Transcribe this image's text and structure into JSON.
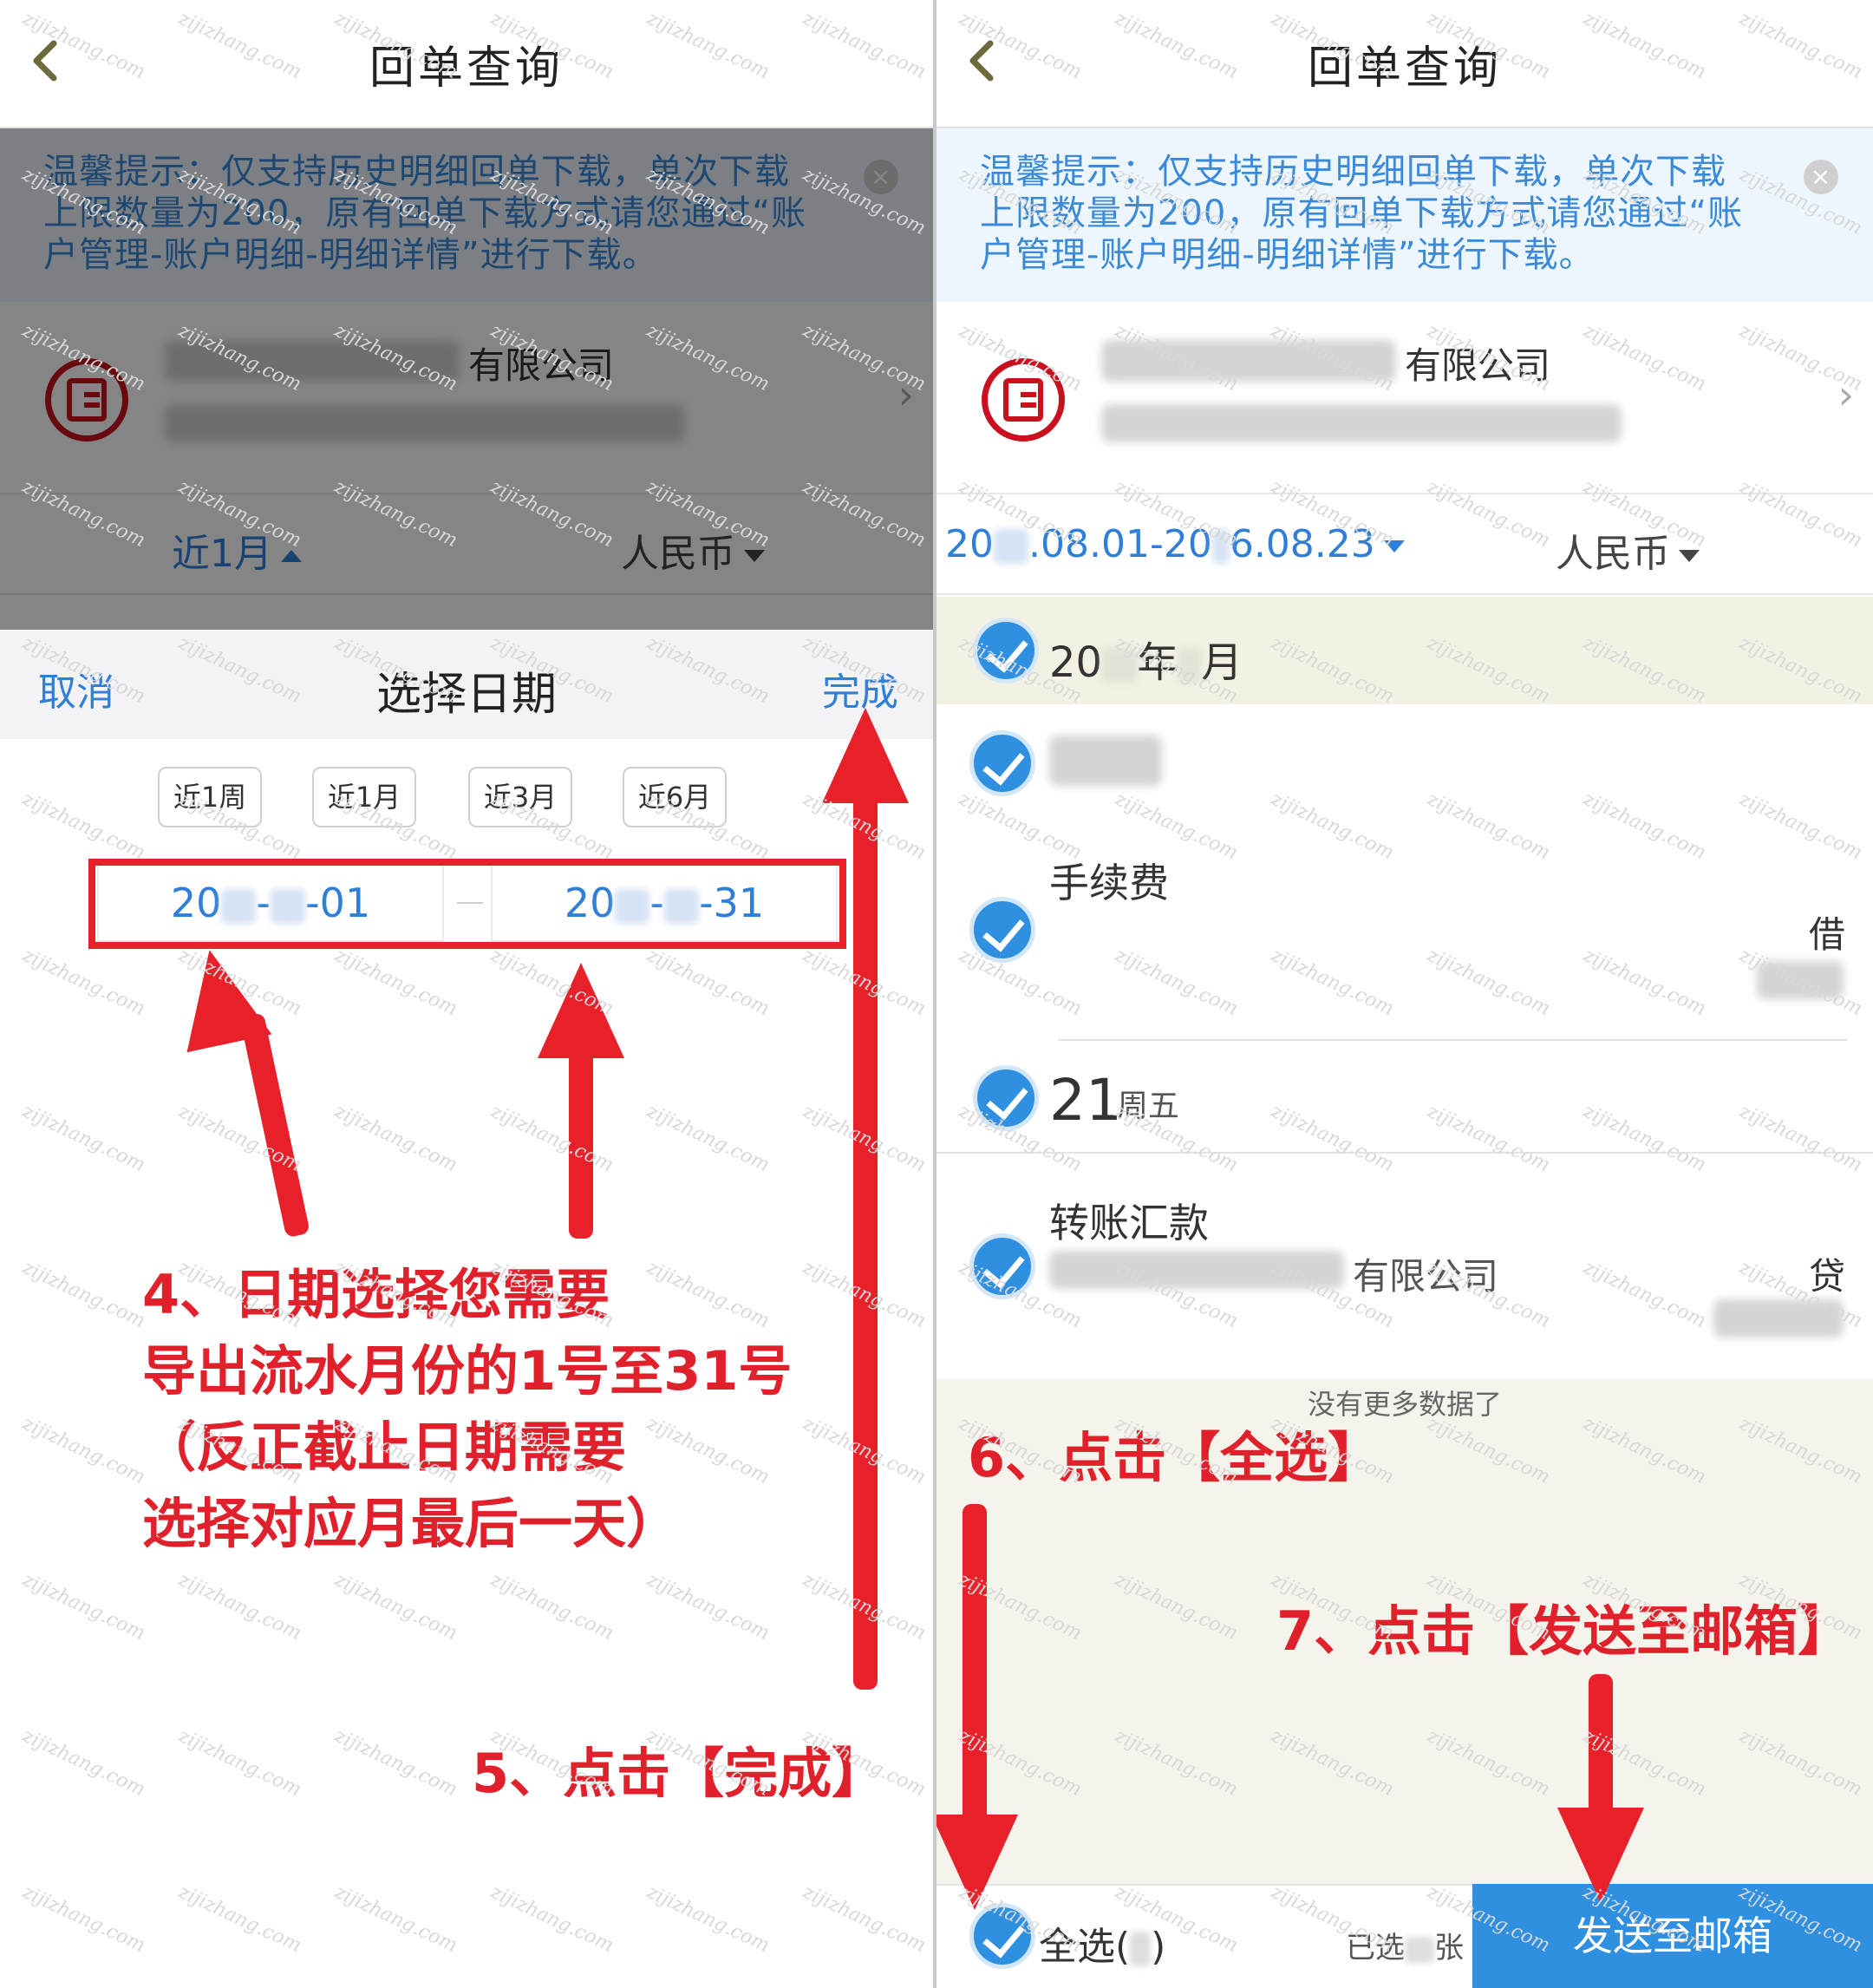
{
  "left": {
    "nav": {
      "title": "回单查询"
    },
    "tip": {
      "text": "温馨提示：仅支持历史明细回单下载，单次下载上限数量为200，原有回单下载方式请您通过“账户管理-账户明细-明细详情”进行下载。",
      "close": "×"
    },
    "account": {
      "name_suffix": "有限公司",
      "chevron": "›"
    },
    "filter": {
      "period": "近1月",
      "currency": "人民币"
    },
    "sheet": {
      "cancel": "取消",
      "title": "选择日期",
      "done": "完成"
    },
    "chips": [
      "近1周",
      "近1月",
      "近3月",
      "近6月"
    ],
    "date_start": {
      "prefix": "20",
      "mid": "-",
      "suffix": "-01"
    },
    "date_end": {
      "prefix": "20",
      "mid": "-",
      "suffix": "-31"
    },
    "annotations": {
      "step4_line1": "4、日期选择您需要",
      "step4_line2": "导出流水月份的1号至31号",
      "step4_line3": "（反正截止日期需要",
      "step4_line4": "选择对应月最后一天）",
      "step5": "5、点击【完成】"
    }
  },
  "right": {
    "nav": {
      "title": "回单查询"
    },
    "tip": {
      "text": "温馨提示：仅支持历史明细回单下载，单次下载上限数量为200，原有回单下载方式请您通过“账户管理-账户明细-明细详情”进行下载。",
      "close": "×"
    },
    "account": {
      "name_suffix": "有限公司",
      "chevron": "›"
    },
    "filter": {
      "range_a": "20",
      "range_b": ".08.01-20",
      "range_c": "6.08.23",
      "currency": "人民币"
    },
    "group": {
      "year_prefix": "20",
      "year_char": "年",
      "month_char": "月"
    },
    "items": [
      {
        "title": "手续费",
        "direction": "借"
      },
      {
        "day": "21",
        "weekday": "周五"
      },
      {
        "title": "转账汇款",
        "counterparty_suffix": "有限公司",
        "direction": "贷"
      }
    ],
    "no_more": "没有更多数据了",
    "select_all": "全选(",
    "select_all_close": ")",
    "selected_prefix": "已选",
    "selected_suffix": "张",
    "send_button": "发送至邮箱",
    "annotations": {
      "step6": "6、点击【全选】",
      "step7": "7、点击【发送至邮箱】"
    }
  },
  "colors": {
    "accent": "#2f8fe0",
    "annotation": "#e0212b",
    "tip_bg": "#eef6fd",
    "group_bg": "#f2f1e4"
  },
  "watermark": "zijizhang.com"
}
